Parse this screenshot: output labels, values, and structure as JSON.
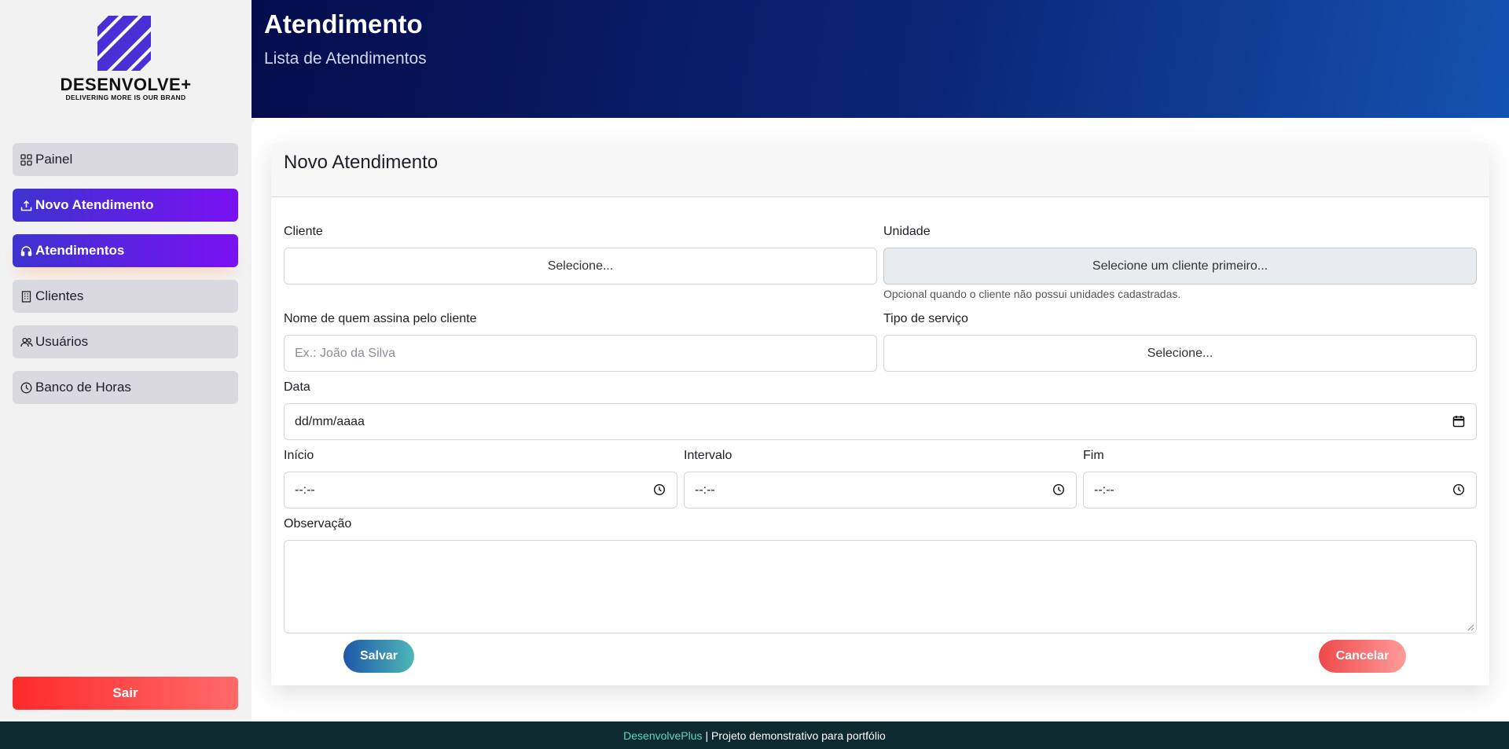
{
  "brand": {
    "name": "DESENVOLVE+",
    "tagline": "DELIVERING MORE IS OUR BRAND",
    "logo_color": "#4a2fd6"
  },
  "sidebar": {
    "items": [
      {
        "label": "Painel",
        "icon": "grid-icon",
        "active": false
      },
      {
        "label": "Novo Atendimento",
        "icon": "upload-icon",
        "active": true
      },
      {
        "label": "Atendimentos",
        "icon": "headset-icon",
        "active": true
      },
      {
        "label": "Clientes",
        "icon": "building-icon",
        "active": false
      },
      {
        "label": "Usuários",
        "icon": "users-icon",
        "active": false
      },
      {
        "label": "Banco de Horas",
        "icon": "clock-icon",
        "active": false
      }
    ],
    "logout_label": "Sair"
  },
  "header": {
    "title": "Atendimento",
    "subtitle": "Lista de Atendimentos"
  },
  "form": {
    "title": "Novo Atendimento",
    "cliente": {
      "label": "Cliente",
      "value": "Selecione..."
    },
    "unidade": {
      "label": "Unidade",
      "value": "Selecione um cliente primeiro...",
      "hint": "Opcional quando o cliente não possui unidades cadastradas."
    },
    "assinante": {
      "label": "Nome de quem assina pelo cliente",
      "placeholder": "Ex.: João da Silva"
    },
    "tipo_servico": {
      "label": "Tipo de serviço",
      "value": "Selecione..."
    },
    "data": {
      "label": "Data",
      "value": "dd/mm/aaaa"
    },
    "inicio": {
      "label": "Início",
      "value": "--:--"
    },
    "intervalo": {
      "label": "Intervalo",
      "value": "--:--"
    },
    "fim": {
      "label": "Fim",
      "value": "--:--"
    },
    "observacao": {
      "label": "Observação"
    },
    "save_label": "Salvar",
    "cancel_label": "Cancelar"
  },
  "footer": {
    "brand": "DesenvolvePlus",
    "text": "| Projeto demonstrativo para portfólio"
  },
  "colors": {
    "accent_start": "#3d33cf",
    "accent_end": "#7a11f2",
    "header_dark": "#040c4c",
    "danger": "#ff2a2a",
    "footer_bg": "#0d2a31"
  }
}
